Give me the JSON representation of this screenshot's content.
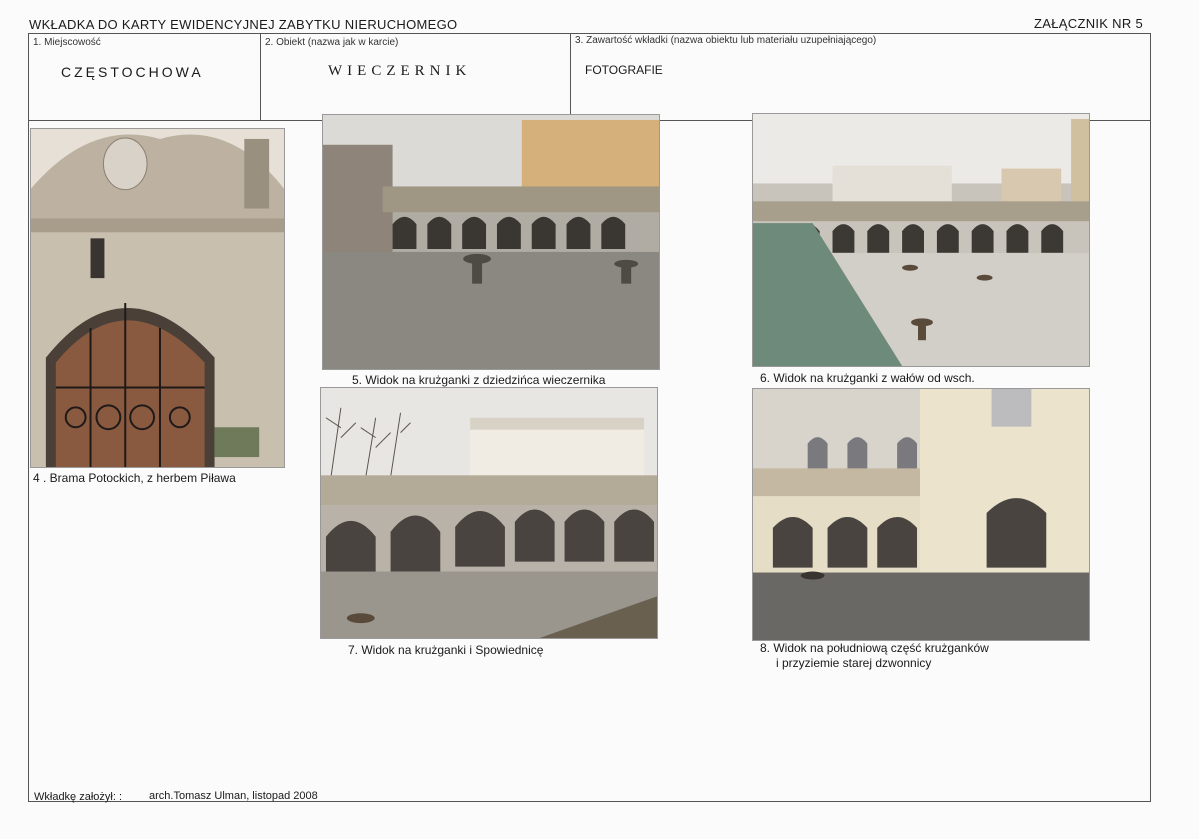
{
  "header": {
    "title": "WKŁADKA DO KARTY EWIDENCYJNEJ ZABYTKU NIERUCHOMEGO",
    "annex": "ZAŁĄCZNIK NR  5"
  },
  "fields": {
    "locality_label": "1. Miejscowość",
    "locality_value": "CZĘSTOCHOWA",
    "object_label": "2. Obiekt (nazwa jak w karcie)",
    "object_value": "WIECZERNIK",
    "content_label": "3. Zawartość wkładki (nazwa obiektu lub materiału uzupełniającego)",
    "content_value": "FOTOGRAFIE"
  },
  "photos": [
    {
      "caption": "4 .  Brama Potockich, z herbem Piława"
    },
    {
      "caption": "5. Widok na krużganki z dziedzińca wieczernika"
    },
    {
      "caption": "6. Widok na  krużganki  z wałów od wsch."
    },
    {
      "caption": "7. Widok  na krużganki i Spowiednicę"
    },
    {
      "caption_line1": "8. Widok na  południową część krużganków",
      "caption_line2": "i  przyziemie  starej dzwonnicy"
    }
  ],
  "footer": {
    "label": "Wkładkę założył:    :",
    "value": "arch.Tomasz Ulman, listopad 2008"
  }
}
